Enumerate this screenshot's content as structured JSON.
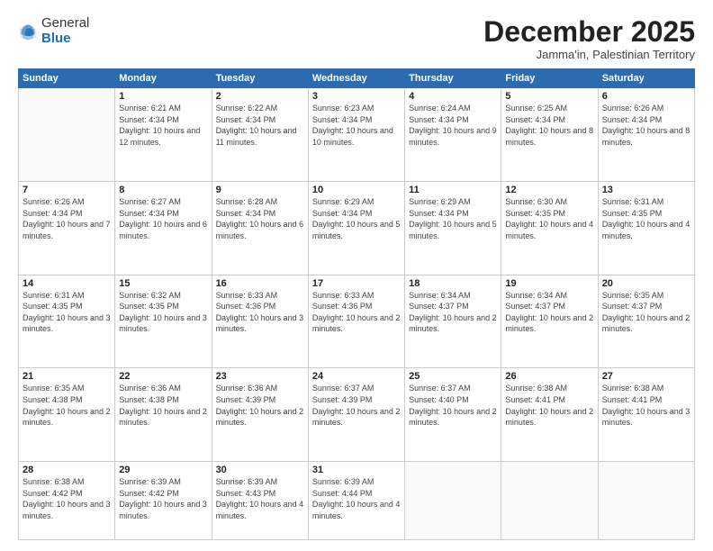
{
  "header": {
    "logo_general": "General",
    "logo_blue": "Blue",
    "title": "December 2025",
    "location": "Jamma'in, Palestinian Territory"
  },
  "weekdays": [
    "Sunday",
    "Monday",
    "Tuesday",
    "Wednesday",
    "Thursday",
    "Friday",
    "Saturday"
  ],
  "weeks": [
    [
      {
        "day": "",
        "sunrise": "",
        "sunset": "",
        "daylight": ""
      },
      {
        "day": "1",
        "sunrise": "Sunrise: 6:21 AM",
        "sunset": "Sunset: 4:34 PM",
        "daylight": "Daylight: 10 hours and 12 minutes."
      },
      {
        "day": "2",
        "sunrise": "Sunrise: 6:22 AM",
        "sunset": "Sunset: 4:34 PM",
        "daylight": "Daylight: 10 hours and 11 minutes."
      },
      {
        "day": "3",
        "sunrise": "Sunrise: 6:23 AM",
        "sunset": "Sunset: 4:34 PM",
        "daylight": "Daylight: 10 hours and 10 minutes."
      },
      {
        "day": "4",
        "sunrise": "Sunrise: 6:24 AM",
        "sunset": "Sunset: 4:34 PM",
        "daylight": "Daylight: 10 hours and 9 minutes."
      },
      {
        "day": "5",
        "sunrise": "Sunrise: 6:25 AM",
        "sunset": "Sunset: 4:34 PM",
        "daylight": "Daylight: 10 hours and 8 minutes."
      },
      {
        "day": "6",
        "sunrise": "Sunrise: 6:26 AM",
        "sunset": "Sunset: 4:34 PM",
        "daylight": "Daylight: 10 hours and 8 minutes."
      }
    ],
    [
      {
        "day": "7",
        "sunrise": "Sunrise: 6:26 AM",
        "sunset": "Sunset: 4:34 PM",
        "daylight": "Daylight: 10 hours and 7 minutes."
      },
      {
        "day": "8",
        "sunrise": "Sunrise: 6:27 AM",
        "sunset": "Sunset: 4:34 PM",
        "daylight": "Daylight: 10 hours and 6 minutes."
      },
      {
        "day": "9",
        "sunrise": "Sunrise: 6:28 AM",
        "sunset": "Sunset: 4:34 PM",
        "daylight": "Daylight: 10 hours and 6 minutes."
      },
      {
        "day": "10",
        "sunrise": "Sunrise: 6:29 AM",
        "sunset": "Sunset: 4:34 PM",
        "daylight": "Daylight: 10 hours and 5 minutes."
      },
      {
        "day": "11",
        "sunrise": "Sunrise: 6:29 AM",
        "sunset": "Sunset: 4:34 PM",
        "daylight": "Daylight: 10 hours and 5 minutes."
      },
      {
        "day": "12",
        "sunrise": "Sunrise: 6:30 AM",
        "sunset": "Sunset: 4:35 PM",
        "daylight": "Daylight: 10 hours and 4 minutes."
      },
      {
        "day": "13",
        "sunrise": "Sunrise: 6:31 AM",
        "sunset": "Sunset: 4:35 PM",
        "daylight": "Daylight: 10 hours and 4 minutes."
      }
    ],
    [
      {
        "day": "14",
        "sunrise": "Sunrise: 6:31 AM",
        "sunset": "Sunset: 4:35 PM",
        "daylight": "Daylight: 10 hours and 3 minutes."
      },
      {
        "day": "15",
        "sunrise": "Sunrise: 6:32 AM",
        "sunset": "Sunset: 4:35 PM",
        "daylight": "Daylight: 10 hours and 3 minutes."
      },
      {
        "day": "16",
        "sunrise": "Sunrise: 6:33 AM",
        "sunset": "Sunset: 4:36 PM",
        "daylight": "Daylight: 10 hours and 3 minutes."
      },
      {
        "day": "17",
        "sunrise": "Sunrise: 6:33 AM",
        "sunset": "Sunset: 4:36 PM",
        "daylight": "Daylight: 10 hours and 2 minutes."
      },
      {
        "day": "18",
        "sunrise": "Sunrise: 6:34 AM",
        "sunset": "Sunset: 4:37 PM",
        "daylight": "Daylight: 10 hours and 2 minutes."
      },
      {
        "day": "19",
        "sunrise": "Sunrise: 6:34 AM",
        "sunset": "Sunset: 4:37 PM",
        "daylight": "Daylight: 10 hours and 2 minutes."
      },
      {
        "day": "20",
        "sunrise": "Sunrise: 6:35 AM",
        "sunset": "Sunset: 4:37 PM",
        "daylight": "Daylight: 10 hours and 2 minutes."
      }
    ],
    [
      {
        "day": "21",
        "sunrise": "Sunrise: 6:35 AM",
        "sunset": "Sunset: 4:38 PM",
        "daylight": "Daylight: 10 hours and 2 minutes."
      },
      {
        "day": "22",
        "sunrise": "Sunrise: 6:36 AM",
        "sunset": "Sunset: 4:38 PM",
        "daylight": "Daylight: 10 hours and 2 minutes."
      },
      {
        "day": "23",
        "sunrise": "Sunrise: 6:36 AM",
        "sunset": "Sunset: 4:39 PM",
        "daylight": "Daylight: 10 hours and 2 minutes."
      },
      {
        "day": "24",
        "sunrise": "Sunrise: 6:37 AM",
        "sunset": "Sunset: 4:39 PM",
        "daylight": "Daylight: 10 hours and 2 minutes."
      },
      {
        "day": "25",
        "sunrise": "Sunrise: 6:37 AM",
        "sunset": "Sunset: 4:40 PM",
        "daylight": "Daylight: 10 hours and 2 minutes."
      },
      {
        "day": "26",
        "sunrise": "Sunrise: 6:38 AM",
        "sunset": "Sunset: 4:41 PM",
        "daylight": "Daylight: 10 hours and 2 minutes."
      },
      {
        "day": "27",
        "sunrise": "Sunrise: 6:38 AM",
        "sunset": "Sunset: 4:41 PM",
        "daylight": "Daylight: 10 hours and 3 minutes."
      }
    ],
    [
      {
        "day": "28",
        "sunrise": "Sunrise: 6:38 AM",
        "sunset": "Sunset: 4:42 PM",
        "daylight": "Daylight: 10 hours and 3 minutes."
      },
      {
        "day": "29",
        "sunrise": "Sunrise: 6:39 AM",
        "sunset": "Sunset: 4:42 PM",
        "daylight": "Daylight: 10 hours and 3 minutes."
      },
      {
        "day": "30",
        "sunrise": "Sunrise: 6:39 AM",
        "sunset": "Sunset: 4:43 PM",
        "daylight": "Daylight: 10 hours and 4 minutes."
      },
      {
        "day": "31",
        "sunrise": "Sunrise: 6:39 AM",
        "sunset": "Sunset: 4:44 PM",
        "daylight": "Daylight: 10 hours and 4 minutes."
      },
      {
        "day": "",
        "sunrise": "",
        "sunset": "",
        "daylight": ""
      },
      {
        "day": "",
        "sunrise": "",
        "sunset": "",
        "daylight": ""
      },
      {
        "day": "",
        "sunrise": "",
        "sunset": "",
        "daylight": ""
      }
    ]
  ]
}
